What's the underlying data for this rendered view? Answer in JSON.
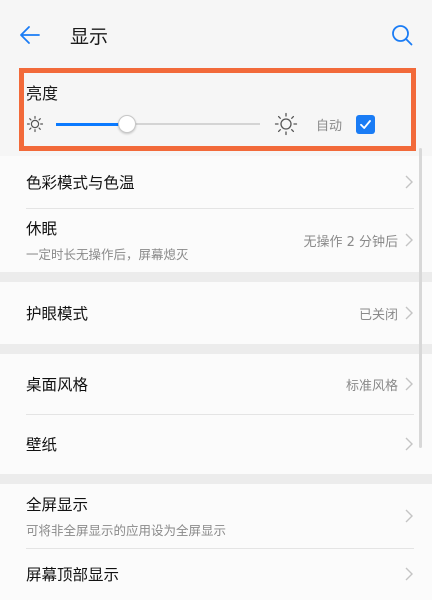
{
  "header": {
    "title": "显示",
    "back_icon": "arrow-left-icon",
    "search_icon": "search-icon"
  },
  "brightness": {
    "title": "亮度",
    "level": 0.35,
    "auto_label": "自动",
    "auto_checked": true,
    "low_icon": "sun-small-icon",
    "high_icon": "sun-large-icon"
  },
  "rows": {
    "color_mode": {
      "title": "色彩模式与色温"
    },
    "sleep": {
      "title": "休眠",
      "subtitle": "一定时长无操作后，屏幕熄灭",
      "value": "无操作 2 分钟后"
    },
    "eye_comfort": {
      "title": "护眼模式",
      "value": "已关闭"
    },
    "home_style": {
      "title": "桌面风格",
      "value": "标准风格"
    },
    "wallpaper": {
      "title": "壁纸"
    },
    "full_screen": {
      "title": "全屏显示",
      "subtitle": "可将非全屏显示的应用设为全屏显示"
    },
    "top_display": {
      "title": "屏幕顶部显示"
    }
  },
  "colors": {
    "accent": "#1a7cf5",
    "highlight_border": "#f26a3a",
    "secondary_text": "#8a8a8a"
  }
}
